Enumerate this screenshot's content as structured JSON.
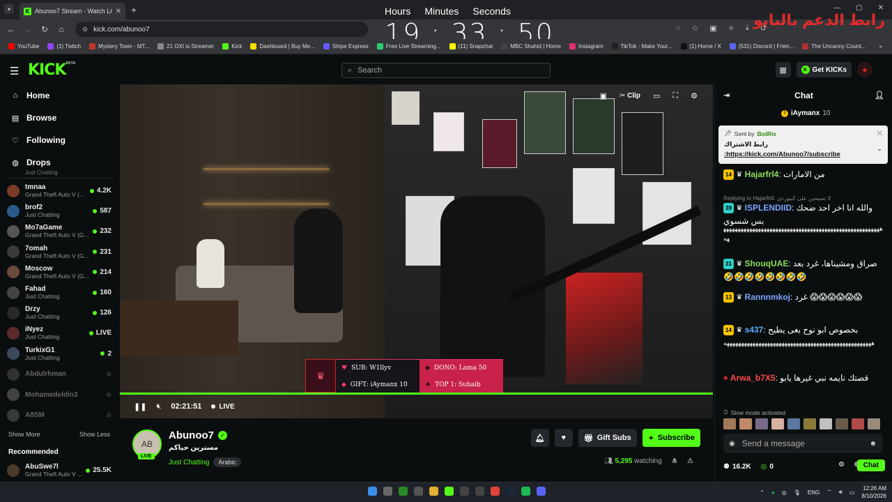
{
  "browser": {
    "tab_title": "Abunoo7 Stream - Watch Live o",
    "url": "kick.com/abunoo7",
    "bookmarks": [
      {
        "label": "YouTube",
        "color": "#ff0000"
      },
      {
        "label": "(1) Twitch",
        "color": "#9146ff"
      },
      {
        "label": "Mystery Town - MT...",
        "color": "#c0392b"
      },
      {
        "label": "21 OXI is Streamer",
        "color": "#888888"
      },
      {
        "label": "Kick",
        "color": "#53fc18"
      },
      {
        "label": "Dashboard | Buy Me...",
        "color": "#ffdd00"
      },
      {
        "label": "Stripe Express",
        "color": "#635bff"
      },
      {
        "label": "Free Live Streaming...",
        "color": "#2ecc71"
      },
      {
        "label": "(11) Snapchat",
        "color": "#fffc00"
      },
      {
        "label": "MBC Shahid | Home",
        "color": "#444444"
      },
      {
        "label": "Instagram",
        "color": "#e1306c"
      },
      {
        "label": "TikTok - Make Your...",
        "color": "#222222"
      },
      {
        "label": "(1) Home / X",
        "color": "#111111"
      },
      {
        "label": "(531) Discord | Frien...",
        "color": "#5865f2"
      },
      {
        "label": "The Uncanny Count...",
        "color": "#b03030"
      }
    ]
  },
  "clock": {
    "hours_label": "Hours",
    "minutes_label": "Minutes",
    "seconds_label": "Seconds",
    "time": "19 : 33 : 50"
  },
  "overlay_red_text": "رابط الدعم بالبايو",
  "header": {
    "logo": "KICK",
    "logo_sup": "BETA",
    "search_placeholder": "Search",
    "get_kicks": "Get KICKs"
  },
  "sidebar": {
    "nav": [
      {
        "label": "Home",
        "icon": "⌂"
      },
      {
        "label": "Browse",
        "icon": "▤"
      },
      {
        "label": "Following",
        "icon": "♡"
      },
      {
        "label": "Drops",
        "icon": "◍"
      }
    ],
    "partial_category": "Just Chatting",
    "channels": [
      {
        "name": "tmnaa",
        "category": "Grand Theft Auto V (...",
        "viewers": "4.2K",
        "color": "#7a3a2a"
      },
      {
        "name": "brof2",
        "category": "Just Chatting",
        "viewers": "587",
        "color": "#2a5a8a"
      },
      {
        "name": "Mo7aGame",
        "category": "Grand Theft Auto V (G...",
        "viewers": "232",
        "color": "#555555"
      },
      {
        "name": "7omah",
        "category": "Grand Theft Auto V (G...",
        "viewers": "231",
        "color": "#3a3a3a"
      },
      {
        "name": "Moscow",
        "category": "Grand Theft Auto V (G...",
        "viewers": "214",
        "color": "#6a4a3a"
      },
      {
        "name": "Fahad",
        "category": "Just Chatting",
        "viewers": "160",
        "color": "#444444"
      },
      {
        "name": "Drzy",
        "category": "Just Chatting",
        "viewers": "126",
        "color": "#2a2a2a"
      },
      {
        "name": "iNyez",
        "category": "Just Chatting",
        "viewers": "LIVE",
        "color": "#5a2a2a"
      },
      {
        "name": "TurkixG1",
        "category": "Just Chatting",
        "viewers": "2",
        "color": "#3a4a5a"
      }
    ],
    "offline": [
      {
        "name": "Abdulrhman",
        "color": "#555555"
      },
      {
        "name": "Mohamedeldin3",
        "color": "#777777"
      },
      {
        "name": "A8SM",
        "color": "#666666"
      }
    ],
    "show_more": "Show More",
    "show_less": "Show Less",
    "recommended_title": "Recommended",
    "recommended": [
      {
        "name": "AbuSwe7l",
        "category": "Grand Theft Auto V ...",
        "viewers": "25.5K",
        "color": "#4a3a2a"
      }
    ]
  },
  "player": {
    "overlay": {
      "sub": "SUB: W1llyv",
      "gift": "GIFT: iAymanx 10",
      "dono": "DONO: Lama 50",
      "top": "TOP 1: Suhaib"
    },
    "elapsed": "02:21:51",
    "live_label": "LIVE",
    "clip_label": "Clip"
  },
  "stream": {
    "avatar_initials": "AB",
    "live_badge": "LIVE",
    "streamer": "Abunoo7",
    "title": "مسترين حياكم",
    "category": "Just Chatting",
    "tag": "Arabic",
    "gift_subs": "Gift Subs",
    "subscribe": "Subscribe",
    "watching_count": "5,295",
    "watching_label": "watching"
  },
  "chat": {
    "title": "Chat",
    "gifter": {
      "name": "iAymanx",
      "count": "10"
    },
    "pinned": {
      "sent_by": "Sent by",
      "bot": "BotRix",
      "line1": "رابط الاشتراك",
      "line2": ":https://kick.com/Abunoo7/subscribe"
    },
    "messages": [
      {
        "badge": "14",
        "user": "Hajarfrl4",
        "color": "#8ee05a",
        "text": "من الامارات"
      },
      {
        "badge": "39",
        "user": "ISPLENDIID",
        "color": "#7aa7ff",
        "text": "والله انا اخر احد ضحك بس شسوي",
        "reply": "Replying to Hajarfrl4: لا تسيحين على كيبوردي"
      },
      {
        "user": "",
        "color": "#ffffff",
        "text": "ههههههههههههههههههههههههههههههههههههههههههههههههههههههههه"
      },
      {
        "badge": "31",
        "user": "ShouqUAE",
        "color": "#8ee05a",
        "text": "صراق ومشيناها، غرد بعد 🤣🤣🤣🤣🤣🤣🤣🤣"
      },
      {
        "badge": "13",
        "user": "Rannnmkoj",
        "color": "#7aa7ff",
        "text": "غرد 😱😱😱😱😱😱"
      },
      {
        "badge": "14",
        "user": "s437",
        "color": "#5ab0ff",
        "text": "بخصوص ابو نوح بغى يطيح"
      },
      {
        "user": "",
        "color": "#ffffff",
        "text": "هههههههههههههههههههههههههههههههههههههههههههههههههههه"
      },
      {
        "user": "Arwa_b7X5",
        "color": "#ff4a4a",
        "text": "قصتك نايمه نبي غيرها يابو"
      }
    ],
    "slow_mode": "Slow mode activated",
    "send_placeholder": "Send a message",
    "foot_kicks": "16.2K",
    "foot_zero": "0",
    "chat_button": "Chat"
  },
  "taskbar": {
    "lang": "ENG",
    "time": "12:26 AM",
    "date": "8/10/2026"
  }
}
